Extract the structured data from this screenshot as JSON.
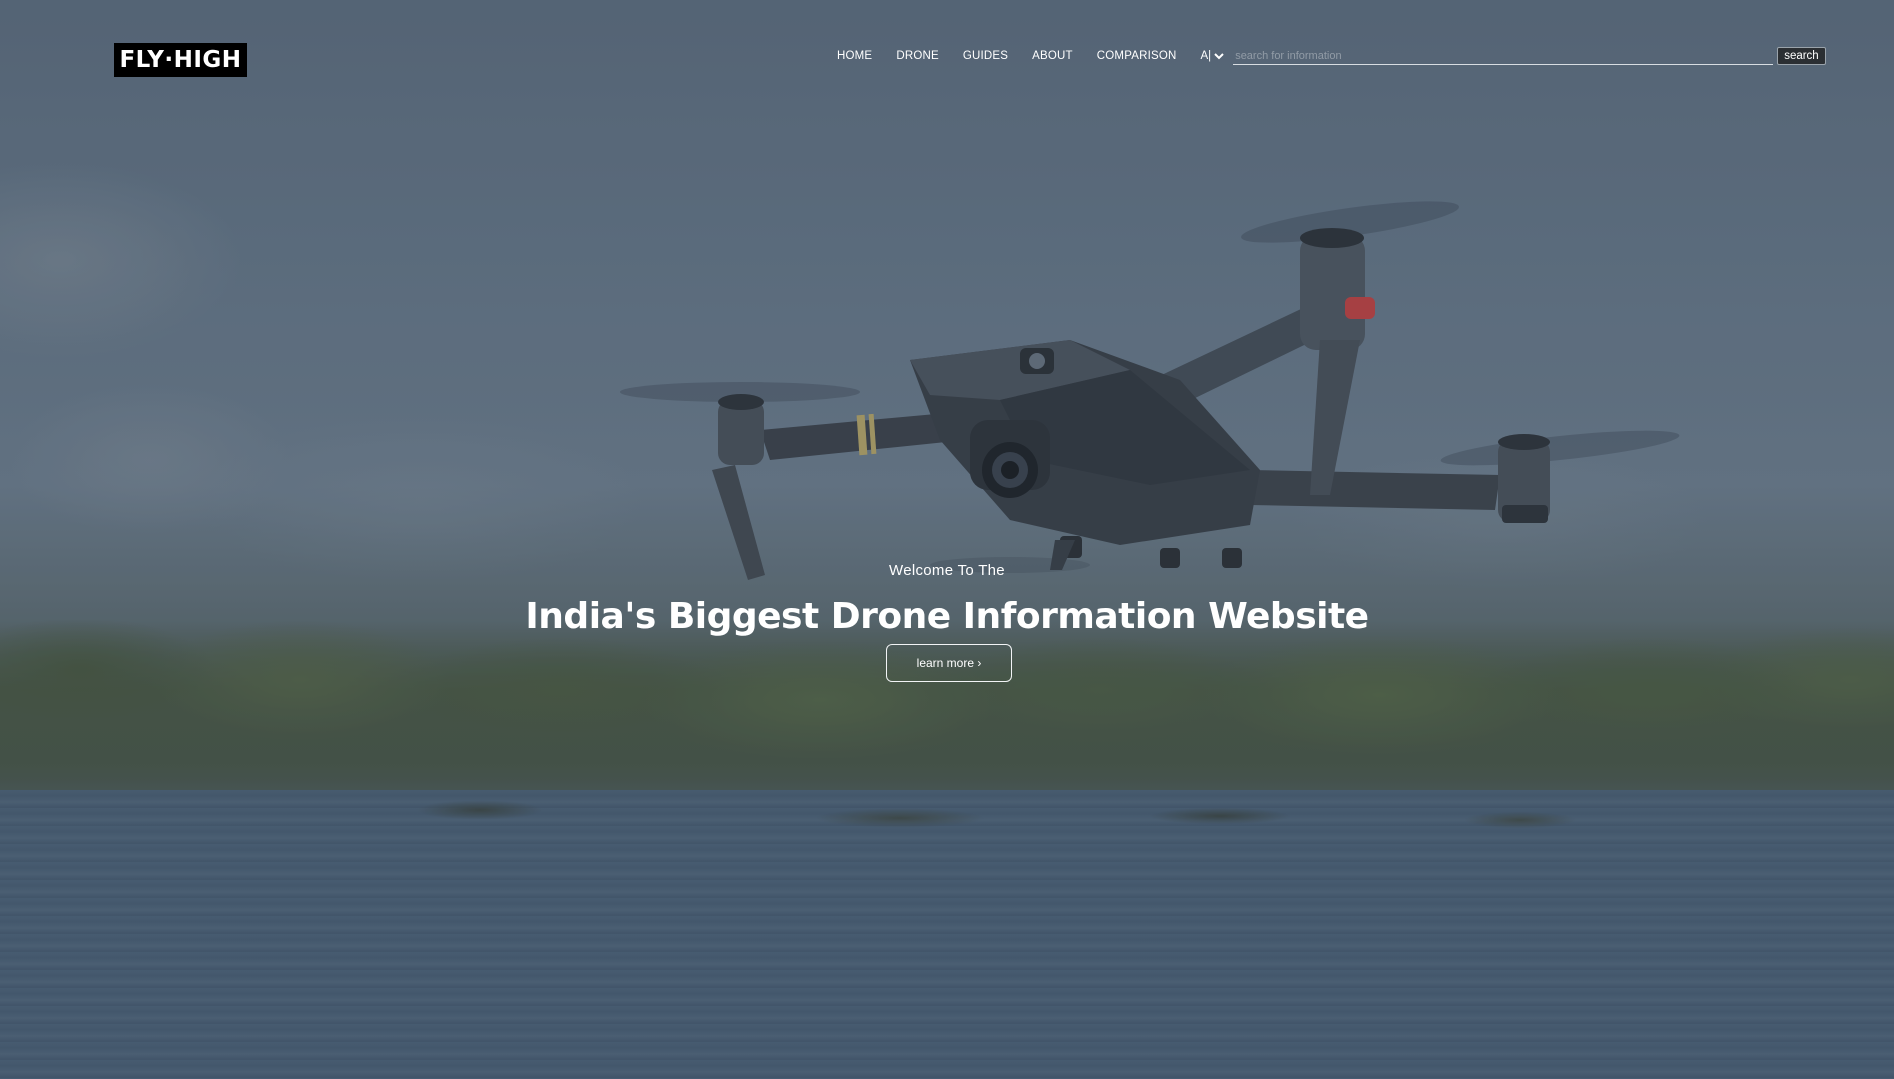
{
  "brand": {
    "logo_text": "FLY·HIGH"
  },
  "nav": {
    "items": [
      {
        "label": "HOME"
      },
      {
        "label": "DRONE"
      },
      {
        "label": "GUIDES"
      },
      {
        "label": "ABOUT"
      },
      {
        "label": "COMPARISON"
      }
    ],
    "language": {
      "selected": "A|"
    },
    "search": {
      "placeholder": "search for information",
      "button_label": "search"
    }
  },
  "hero": {
    "welcome": "Welcome To The",
    "headline": "India's Biggest Drone Information Website",
    "cta_label": "learn more ›"
  },
  "colors": {
    "logo_bg": "#000000",
    "text": "#ffffff",
    "overlay": "#5f6f80"
  }
}
